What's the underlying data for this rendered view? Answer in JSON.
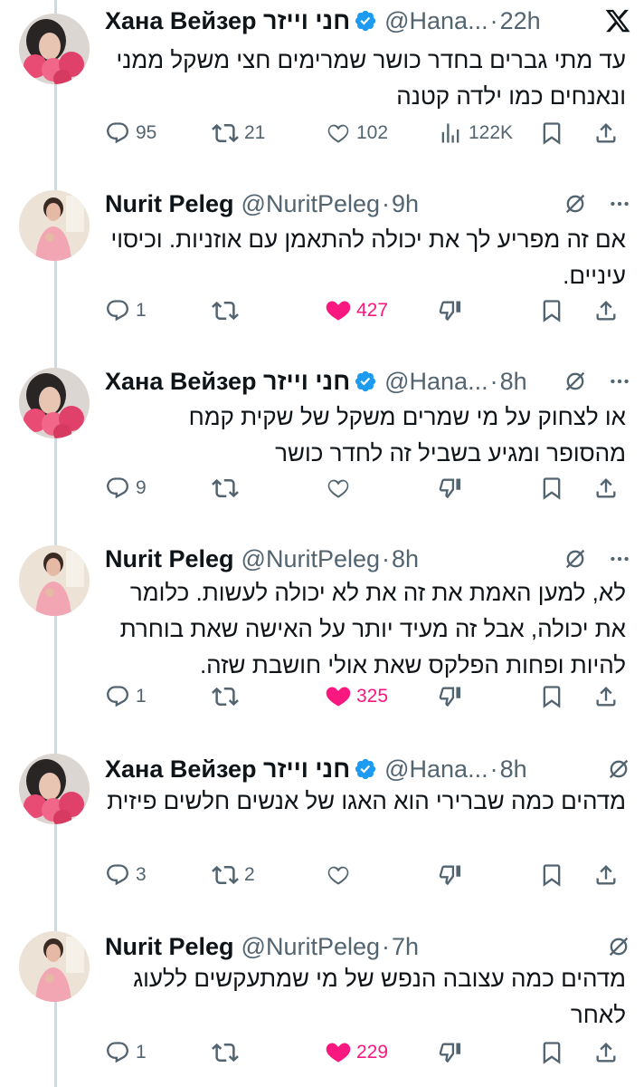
{
  "thread": [
    {
      "author": "Хана Вейзер חני וייזר",
      "verified": true,
      "handle": "@Hana...",
      "time": "22h",
      "text": "עד מתי גברים בחדר כושר שמרימים חצי משקל ממני ונאנחים כמו ילדה קטנה",
      "replies": "95",
      "reposts": "21",
      "likes": "102",
      "views": "122K",
      "liked": false,
      "header_icon": "x-logo-icon",
      "bottom_icons": [
        "reply-icon",
        "repost-icon",
        "like-icon",
        "views-icon",
        "bookmark-icon",
        "share-icon"
      ]
    },
    {
      "author": "Nurit Peleg",
      "verified": false,
      "handle": "@NuritPeleg",
      "time": "9h",
      "text": "אם זה מפריע לך את יכולה להתאמן עם אוזניות. וכיסוי עיניים.",
      "replies": "1",
      "reposts": "",
      "likes": "427",
      "liked": true
    },
    {
      "author": "Хана Вейзер חני וייזר",
      "verified": true,
      "handle": "@Hana...",
      "time": "8h",
      "text": "או לצחוק על מי שמרים משקל של שקית קמח מהסופר ומגיע בשביל זה לחדר כושר",
      "replies": "9",
      "reposts": "",
      "likes": "",
      "liked": false
    },
    {
      "author": "Nurit Peleg",
      "verified": false,
      "handle": "@NuritPeleg",
      "time": "8h",
      "text": "לא, למען האמת את זה את לא יכולה לעשות. כלומר את יכולה, אבל זה מעיד יותר על האישה שאת בוחרת להיות ופחות הפלקס שאת אולי חושבת שזה.",
      "replies": "1",
      "reposts": "",
      "likes": "325",
      "liked": true
    },
    {
      "author": "Хана Вейзер חני וייזר",
      "verified": true,
      "handle": "@Hana...",
      "time": "8h",
      "text": "מדהים כמה שברירי הוא האגו של אנשים חלשים פיזית",
      "replies": "3",
      "reposts": "2",
      "likes": "",
      "liked": false
    },
    {
      "author": "Nurit Peleg",
      "verified": false,
      "handle": "@NuritPeleg",
      "time": "7h",
      "text": "מדהים כמה עצובה הנפש של מי שמתעקשים ללעוג לאחר",
      "replies": "1",
      "reposts": "",
      "likes": "229",
      "liked": true
    }
  ],
  "colors": {
    "text": "#0f1419",
    "secondary": "#536471",
    "like": "#f91880",
    "verified": "#1d9bf0",
    "thread_line": "#cfd9de"
  },
  "separator": "·"
}
